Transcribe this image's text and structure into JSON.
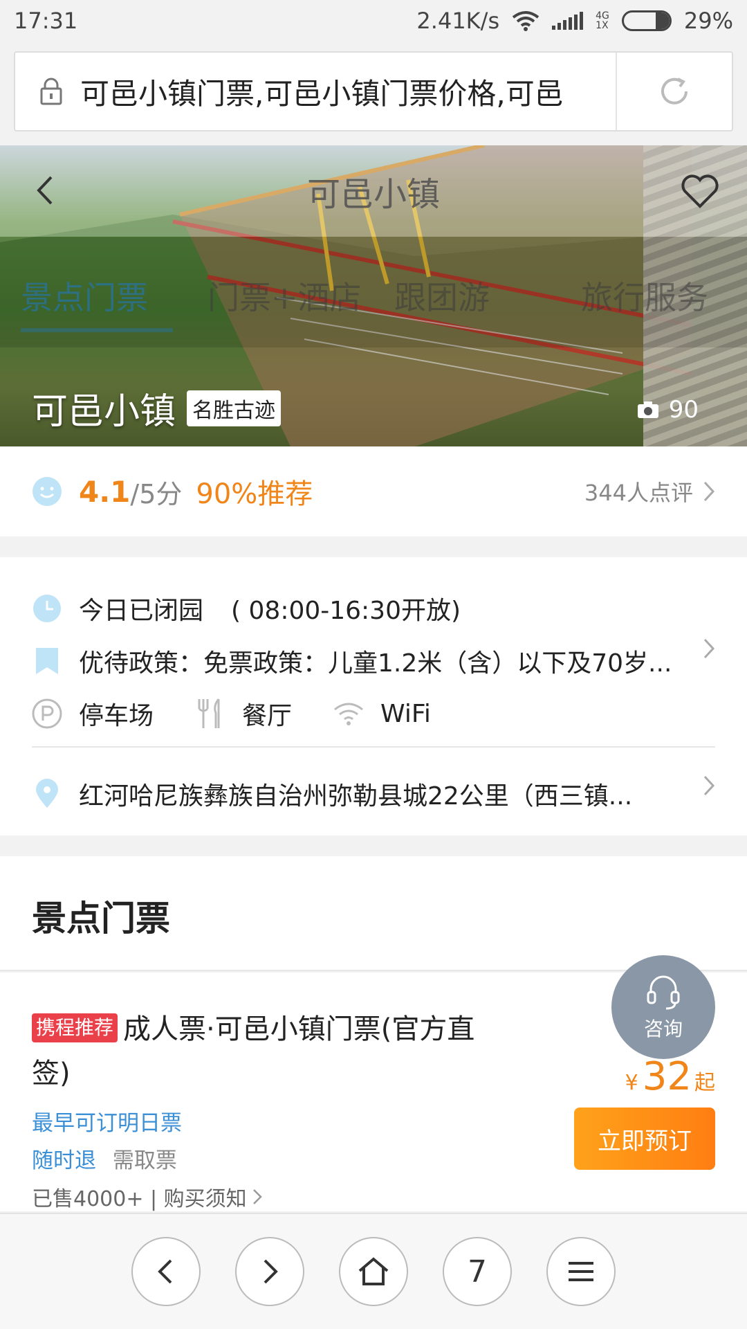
{
  "status_bar": {
    "time": "17:31",
    "network_speed": "2.41K/s",
    "net_top": "4G",
    "net_bottom": "1X",
    "battery": "29%",
    "icons": [
      "wifi-icon",
      "signal-icon",
      "battery-icon"
    ]
  },
  "address_bar": {
    "url": "可邑小镇门票,可邑小镇门票价格,可邑",
    "icons": [
      "lock-icon",
      "reload-icon"
    ]
  },
  "hero": {
    "page_title": "可邑小镇",
    "tabs": [
      "景点门票",
      "门票+酒店",
      "跟团游",
      "旅行服务"
    ],
    "active_tab": 0,
    "name": "可邑小镇",
    "tag": "名胜古迹",
    "photo_count": "90",
    "icons": [
      "back-arrow-icon",
      "heart-icon",
      "camera-icon"
    ]
  },
  "rating": {
    "score": "4.1",
    "out_of": "/5分",
    "recommend": "90%推荐",
    "reviews": "344人点评"
  },
  "info": {
    "hours_status": "今日已闭园",
    "hours": "( 08:00-16:30开放)",
    "policy": "优待政策：免票政策：儿童1.2米（含）以下及70岁...",
    "facilities": [
      "停车场",
      "餐厅",
      "WiFi"
    ],
    "address": "红河哈尼族彝族自治州弥勒县城22公里（西三镇..."
  },
  "tickets": {
    "heading": "景点门票",
    "item": {
      "badge": "携程推荐",
      "title": "成人票·可邑小镇门票(官方直签)",
      "earliest": "最早可订明日票",
      "refund": "随时退",
      "pickup": "需取票",
      "sold_info": "已售4000+ | 购买须知",
      "currency": "¥",
      "price": "32",
      "price_suffix": "起",
      "book_label": "立即预订"
    }
  },
  "consult": {
    "label": "咨询"
  },
  "bottom_nav": {
    "tab_count": "7",
    "buttons": [
      "back-icon",
      "forward-icon",
      "home-icon",
      "tabs-count",
      "menu-icon"
    ]
  },
  "colors": {
    "accent_orange": "#f08519",
    "link_blue": "#3b8fd6",
    "badge_red": "#e9404a",
    "icon_light_blue": "#bfe3f7"
  }
}
